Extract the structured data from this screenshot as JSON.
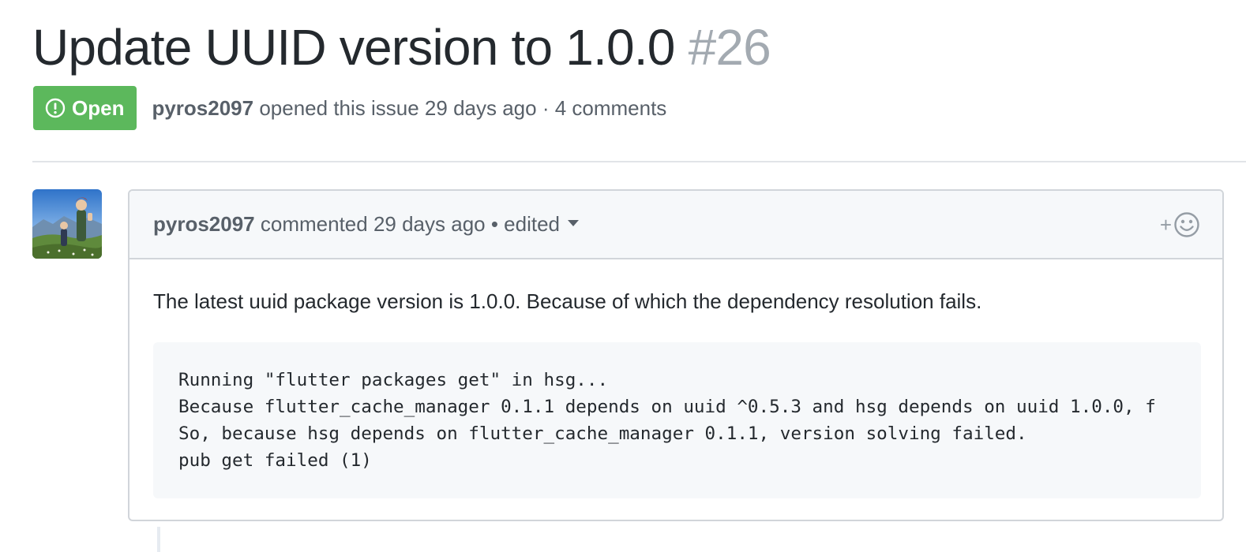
{
  "issue": {
    "title": "Update UUID version to 1.0.0",
    "number": "#26",
    "state_label": "Open",
    "state_color": "#5cb85c",
    "author": "pyros2097",
    "opened_text": "opened this issue 29 days ago · 4 comments"
  },
  "comment": {
    "author": "pyros2097",
    "header_text": "commented 29 days ago • edited",
    "reaction_plus": "+",
    "body_text": "The latest uuid package version is 1.0.0. Because of which the dependency resolution fails.",
    "code_lines": [
      "Running \"flutter packages get\" in hsg...",
      "Because flutter_cache_manager 0.1.1 depends on uuid ^0.5.3 and hsg depends on uuid 1.0.0, f",
      "So, because hsg depends on flutter_cache_manager 0.1.1, version solving failed.",
      "pub get failed (1)"
    ]
  },
  "icons": {
    "state": "issue-opened-icon",
    "reaction": "smiley-icon",
    "edited_dropdown": "triangle-down-icon"
  }
}
